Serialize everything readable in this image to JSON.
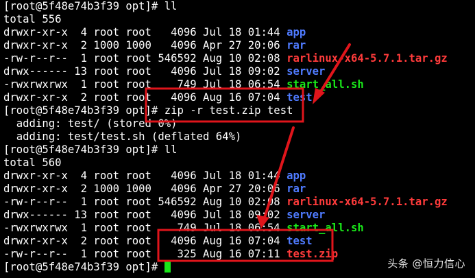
{
  "terminal": {
    "prompt1": "[root@5f48e74b3f39 opt]# ll",
    "total1": "total 556",
    "listing1": [
      {
        "meta": "drwxr-xr-x  4 root root   4096 Jul 18 01:44 ",
        "name": "app",
        "kind": "dir"
      },
      {
        "meta": "drwxr-xr-x  2 1000 1000   4096 Apr 27 20:06 ",
        "name": "rar",
        "kind": "dir"
      },
      {
        "meta": "-rw-r--r--  1 root root 546592 Aug 10 02:08 ",
        "name": "rarlinux-x64-5.7.1.tar.gz",
        "kind": "archive"
      },
      {
        "meta": "drwx------ 13 root root   4096 Jul 18 09:02 ",
        "name": "server",
        "kind": "dir"
      },
      {
        "meta": "-rwxrwxrwx  1 root root    749 Jul 18 06:54 ",
        "name": "start_all.sh",
        "kind": "exec"
      },
      {
        "meta": "drwxr-xr-x  2 root root   4096 Aug 16 07:04 ",
        "name": "test",
        "kind": "dir"
      }
    ],
    "prompt2": "[root@5f48e74b3f39 opt]# zip -r test.zip test",
    "zip_output": [
      "  adding: test/ (stored 0%)",
      "  adding: test/test.sh (deflated 64%)"
    ],
    "prompt3": "[root@5f48e74b3f39 opt]# ll",
    "total2": "total 560",
    "listing2": [
      {
        "meta": "drwxr-xr-x  4 root root   4096 Jul 18 01:44 ",
        "name": "app",
        "kind": "dir"
      },
      {
        "meta": "drwxr-xr-x  2 1000 1000   4096 Apr 27 20:06 ",
        "name": "rar",
        "kind": "dir"
      },
      {
        "meta": "-rw-r--r--  1 root root 546592 Aug 10 02:08 ",
        "name": "rarlinux-x64-5.7.1.tar.gz",
        "kind": "archive"
      },
      {
        "meta": "drwx------ 13 root root   4096 Jul 18 09:02 ",
        "name": "server",
        "kind": "dir"
      },
      {
        "meta": "-rwxrwxrwx  1 root root    749 Jul 18 06:54 ",
        "name": "start_all.sh",
        "kind": "exec"
      },
      {
        "meta": "drwxr-xr-x  2 root root   4096 Aug 16 07:04 ",
        "name": "test",
        "kind": "dir"
      },
      {
        "meta": "-rw-r--r--  1 root root    325 Aug 16 07:11 ",
        "name": "test.zip",
        "kind": "archive"
      }
    ],
    "prompt4": "[root@5f48e74b3f39 opt]# "
  },
  "watermark": "头条 @恒力信心",
  "colors": {
    "background": "#000000",
    "text": "#ffffff",
    "directory": "#4f7bff",
    "archive": "#ff3b3b",
    "executable": "#19e619",
    "annotation": "#e0151b",
    "cursor": "#19e619"
  }
}
